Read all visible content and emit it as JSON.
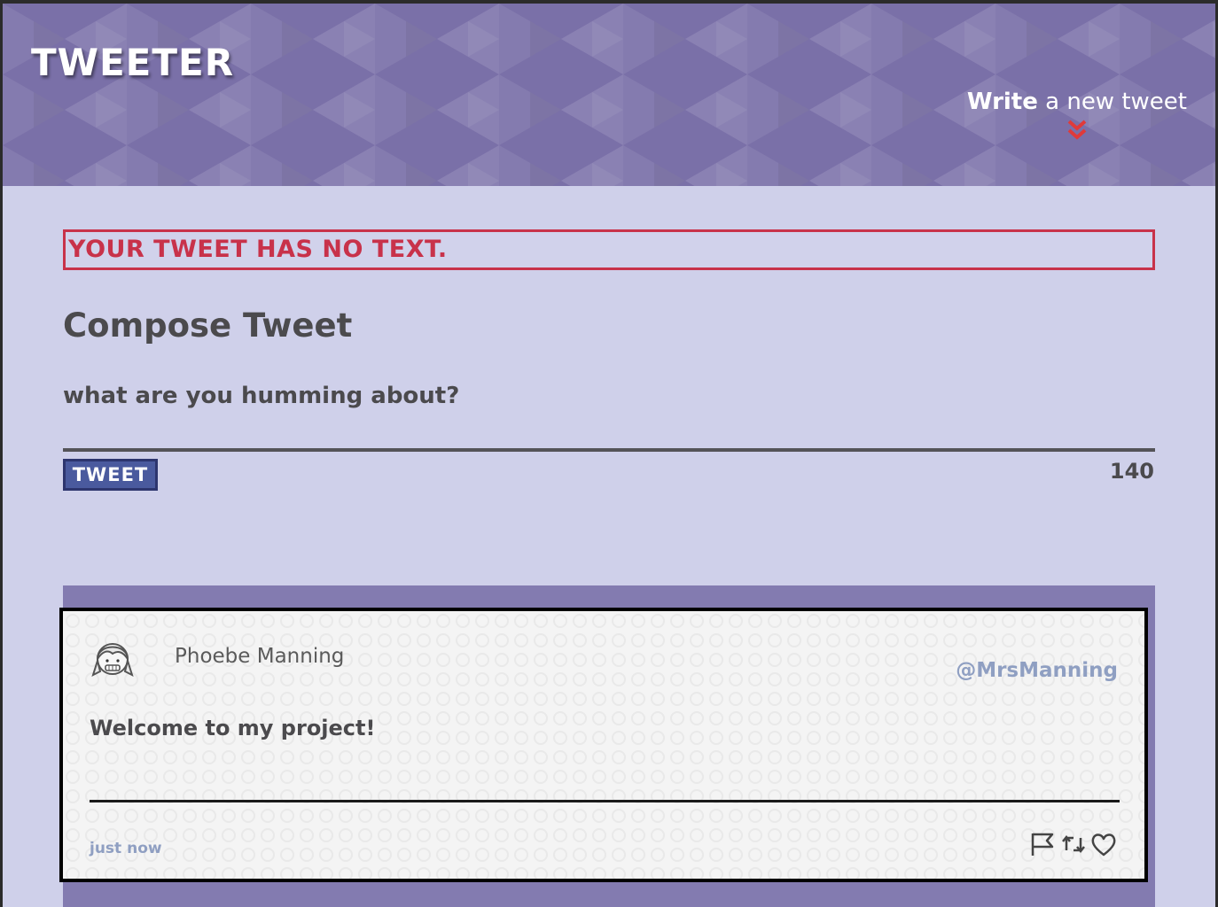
{
  "header": {
    "brand": "TWEETER",
    "write_strong": "Write",
    "write_rest": " a new tweet",
    "arrow_icon": "double-chevron-down-icon",
    "bg_color": "#7a70a8",
    "arrow_color": "#e03a3a"
  },
  "error": {
    "message": "YOUR TWEET HAS NO TEXT.",
    "color": "#c8324a"
  },
  "compose": {
    "title": "Compose Tweet",
    "placeholder": "what are you humming about?",
    "value": "",
    "button_label": "TWEET",
    "counter": "140"
  },
  "tweets": [
    {
      "avatar_icon": "girl-avatar-icon",
      "name": "Phoebe Manning",
      "handle": "@MrsManning",
      "text": "Welcome to my project!",
      "time": "just now",
      "actions": [
        "flag-icon",
        "retweet-icon",
        "heart-icon"
      ]
    }
  ]
}
